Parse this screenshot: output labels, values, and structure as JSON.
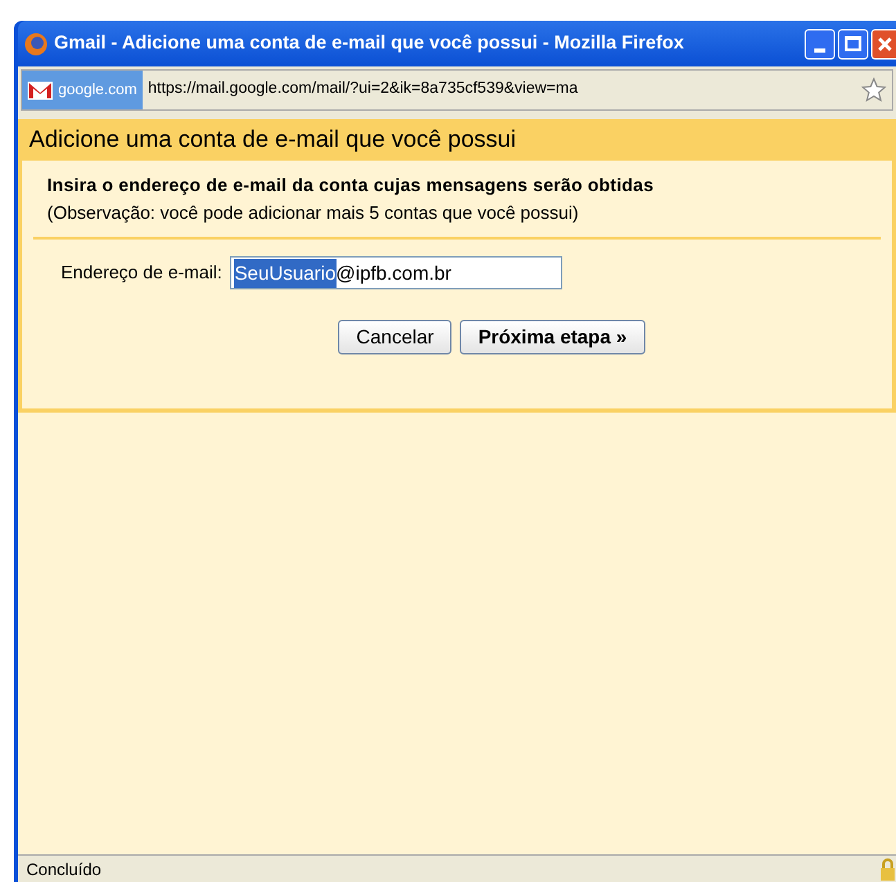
{
  "window": {
    "title": "Gmail - Adicione uma conta de e-mail que você possui - Mozilla Firefox"
  },
  "address_bar": {
    "site": "google.com",
    "url": "https://mail.google.com/mail/?ui=2&ik=8a735cf539&view=ma"
  },
  "dialog": {
    "heading": "Adicione uma conta de e-mail que você possui",
    "instruction": "Insira o endereço de e-mail da conta cujas mensagens serão obtidas",
    "note": "(Observação: você pode adicionar mais 5 contas que você possui)",
    "field": {
      "label": "Endereço de e-mail:",
      "selected_text": "SeuUsuario",
      "rest_text": "@ipfb.com.br"
    },
    "buttons": [
      {
        "label": "Cancelar",
        "kind": "plain"
      },
      {
        "label": "Próxima etapa »",
        "kind": "primary"
      }
    ]
  },
  "status_bar": {
    "text": "Concluído"
  }
}
